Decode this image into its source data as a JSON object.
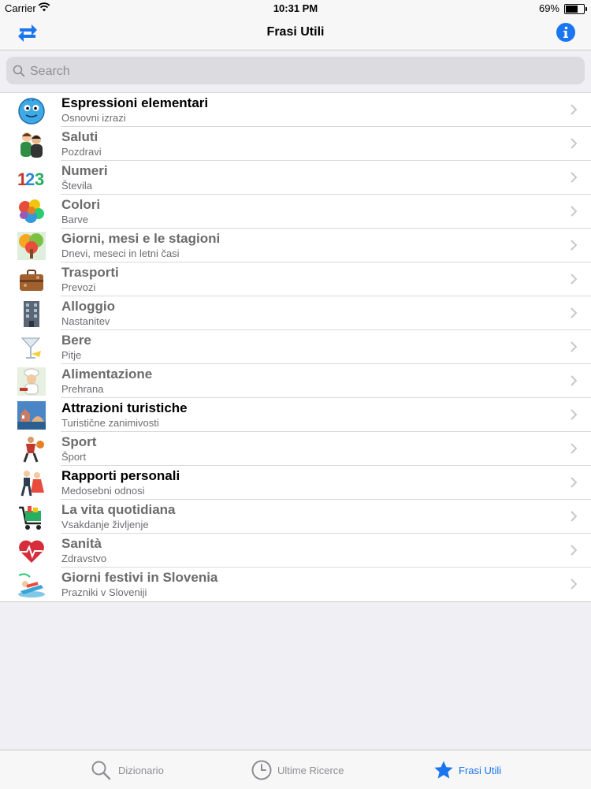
{
  "status": {
    "carrier": "Carrier",
    "time": "10:31 PM",
    "battery": "69%",
    "battery_level": 0.69
  },
  "nav": {
    "title": "Frasi Utili"
  },
  "search": {
    "placeholder": "Search"
  },
  "categories": [
    {
      "title": "Espressioni elementari",
      "subtitle": "Osnovni izrazi",
      "icon": "smiley-face-icon"
    },
    {
      "title": "Saluti",
      "subtitle": "Pozdravi",
      "icon": "greeting-people-icon"
    },
    {
      "title": "Numeri",
      "subtitle": "Števila",
      "icon": "numbers-123-icon",
      "icon_text": "123"
    },
    {
      "title": "Colori",
      "subtitle": "Barve",
      "icon": "color-splash-icon"
    },
    {
      "title": "Giorni, mesi e le stagioni",
      "subtitle": "Dnevi, meseci in letni časi",
      "icon": "seasons-tree-icon"
    },
    {
      "title": "Trasporti",
      "subtitle": "Prevozi",
      "icon": "suitcase-icon"
    },
    {
      "title": "Alloggio",
      "subtitle": "Nastanitev",
      "icon": "hotel-building-icon"
    },
    {
      "title": "Bere",
      "subtitle": "Pitje",
      "icon": "cocktail-glass-icon"
    },
    {
      "title": "Alimentazione",
      "subtitle": "Prehrana",
      "icon": "chef-icon"
    },
    {
      "title": "Attrazioni turistiche",
      "subtitle": "Turistične zanimivosti",
      "icon": "landmark-icon"
    },
    {
      "title": "Sport",
      "subtitle": "Šport",
      "icon": "basketball-player-icon"
    },
    {
      "title": "Rapporti personali",
      "subtitle": "Medosebni odnosi",
      "icon": "dancing-couple-icon"
    },
    {
      "title": "La vita quotidiana",
      "subtitle": "Vsakdanje življenje",
      "icon": "shopping-cart-icon"
    },
    {
      "title": "Sanità",
      "subtitle": "Zdravstvo",
      "icon": "heart-pulse-icon"
    },
    {
      "title": "Giorni festivi in Slovenia",
      "subtitle": "Prazniki v Sloveniji",
      "icon": "beach-chair-icon"
    }
  ],
  "tabs": [
    {
      "label": "Dizionario",
      "icon": "search-icon"
    },
    {
      "label": "Ultime Ricerce",
      "icon": "clock-icon"
    },
    {
      "label": "Frasi Utili",
      "icon": "star-icon",
      "active": true
    }
  ],
  "colors": {
    "accent": "#1a75f0",
    "inactive": "#8e8e93",
    "list_bg": "#ffffff",
    "page_bg": "#efeff4"
  }
}
